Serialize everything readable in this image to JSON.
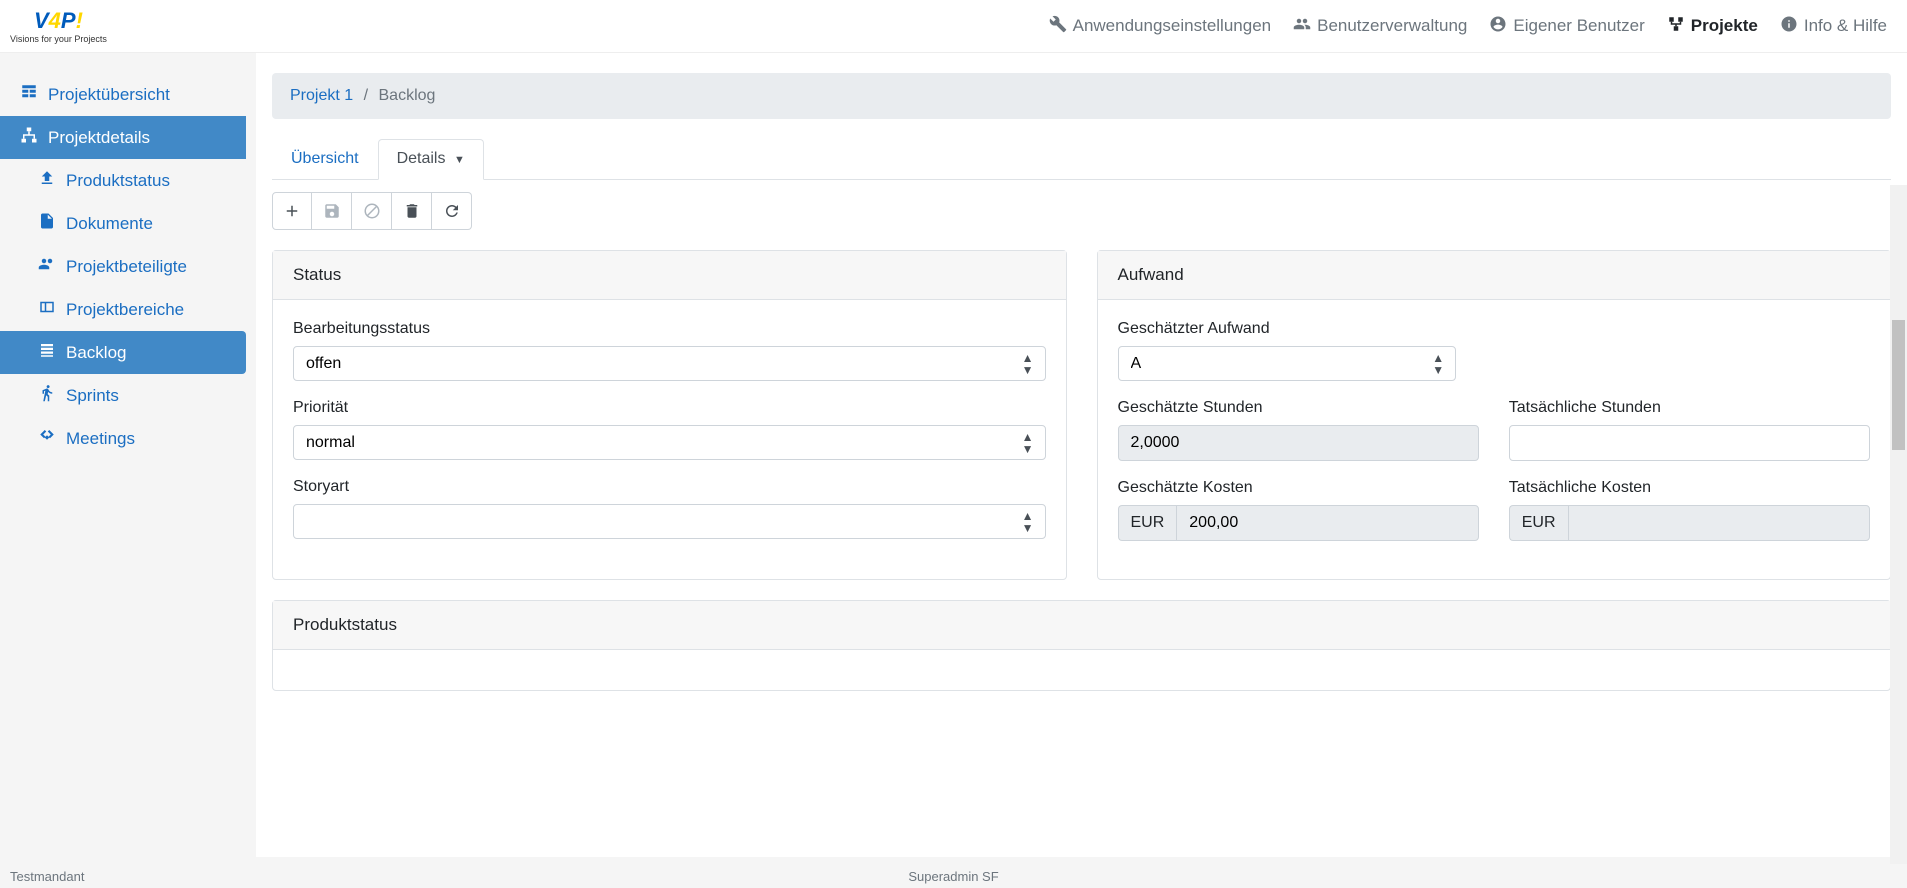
{
  "logo": {
    "sub": "Visions for your Projects"
  },
  "topnav": {
    "settings": "Anwendungseinstellungen",
    "users": "Benutzerverwaltung",
    "ownuser": "Eigener Benutzer",
    "projects": "Projekte",
    "help": "Info & Hilfe"
  },
  "sidebar": {
    "overview": "Projektübersicht",
    "details": "Projektdetails",
    "productstatus": "Produktstatus",
    "documents": "Dokumente",
    "participants": "Projektbeteiligte",
    "areas": "Projektbereiche",
    "backlog": "Backlog",
    "sprints": "Sprints",
    "meetings": "Meetings"
  },
  "breadcrumb": {
    "project": "Projekt 1",
    "sep": "/",
    "current": "Backlog"
  },
  "tabs": {
    "overview": "Übersicht",
    "details": "Details"
  },
  "cards": {
    "status": {
      "title": "Status",
      "bearbeitungsstatus_label": "Bearbeitungsstatus",
      "bearbeitungsstatus_value": "offen",
      "prioritaet_label": "Priorität",
      "prioritaet_value": "normal",
      "storyart_label": "Storyart",
      "storyart_value": ""
    },
    "aufwand": {
      "title": "Aufwand",
      "geschaetzter_aufwand_label": "Geschätzter Aufwand",
      "geschaetzter_aufwand_value": "A",
      "geschaetzte_stunden_label": "Geschätzte Stunden",
      "geschaetzte_stunden_value": "2,0000",
      "tatsaechliche_stunden_label": "Tatsächliche Stunden",
      "tatsaechliche_stunden_value": "",
      "geschaetzte_kosten_label": "Geschätzte Kosten",
      "geschaetzte_kosten_currency": "EUR",
      "geschaetzte_kosten_value": "200,00",
      "tatsaechliche_kosten_label": "Tatsächliche Kosten",
      "tatsaechliche_kosten_currency": "EUR",
      "tatsaechliche_kosten_value": ""
    },
    "produktstatus": {
      "title": "Produktstatus"
    }
  },
  "footer": {
    "left": "Testmandant",
    "center": "Superadmin SF"
  }
}
